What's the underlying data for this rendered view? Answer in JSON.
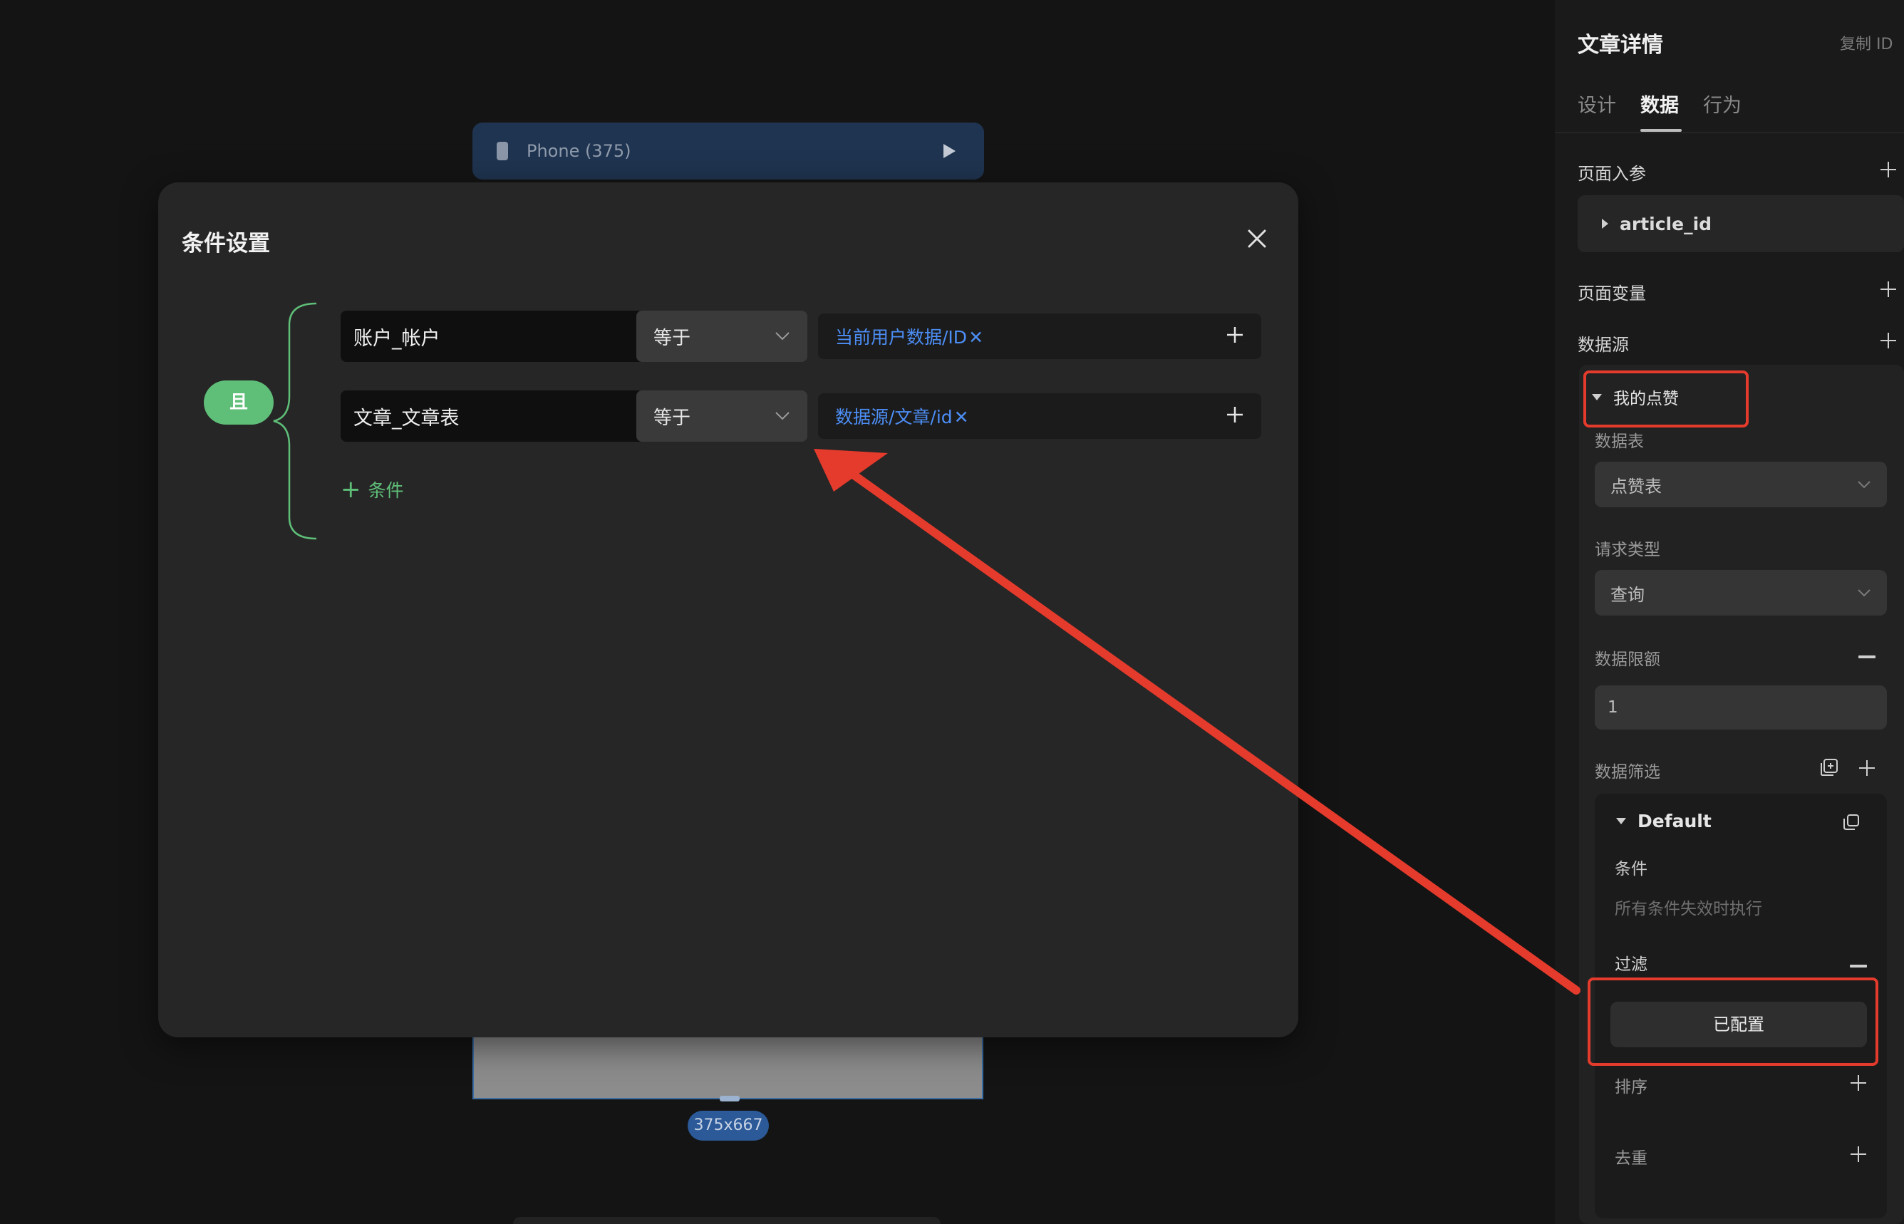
{
  "canvas": {
    "device_label": "Phone (375)",
    "size_badge": "375x667"
  },
  "modal": {
    "title": "条件设置",
    "logic_operator": "且",
    "conditions": [
      {
        "field": "账户_帐户",
        "operator": "等于",
        "value": "当前用户数据/ID",
        "remove_glyph": "✕"
      },
      {
        "field": "文章_文章表",
        "operator": "等于",
        "value": "数据源/文章/id",
        "remove_glyph": "✕"
      }
    ],
    "add_condition_label": "条件",
    "add_glyph": "+"
  },
  "panel": {
    "title": "文章详情",
    "copy_id": "复制 ID",
    "tabs": [
      {
        "label": "设计",
        "active": false
      },
      {
        "label": "数据",
        "active": true
      },
      {
        "label": "行为",
        "active": false
      }
    ],
    "page_params_label": "页面入参",
    "page_param_item": "article_id",
    "page_vars_label": "页面变量",
    "datasource_label": "数据源",
    "datasource": {
      "name": "我的点赞",
      "table_label": "数据表",
      "table_value": "点赞表",
      "request_type_label": "请求类型",
      "request_type_value": "查询",
      "limit_label": "数据限额",
      "limit_value": "1",
      "filter_label": "数据筛选",
      "filter_group": {
        "name": "Default",
        "condition_label": "条件",
        "condition_hint": "所有条件失效时执行",
        "filter_label": "过滤",
        "configured_button": "已配置",
        "sort_label": "排序",
        "dedupe_label": "去重"
      }
    }
  },
  "colors": {
    "accent_green": "#5fbf79",
    "link_blue": "#4c8ef5",
    "annotation_red": "#e43b2c"
  },
  "icons": [
    "phone-icon",
    "play-icon",
    "close-icon",
    "chevron-down-icon",
    "plus-icon",
    "minus-icon",
    "copy-icon",
    "add-group-icon"
  ]
}
